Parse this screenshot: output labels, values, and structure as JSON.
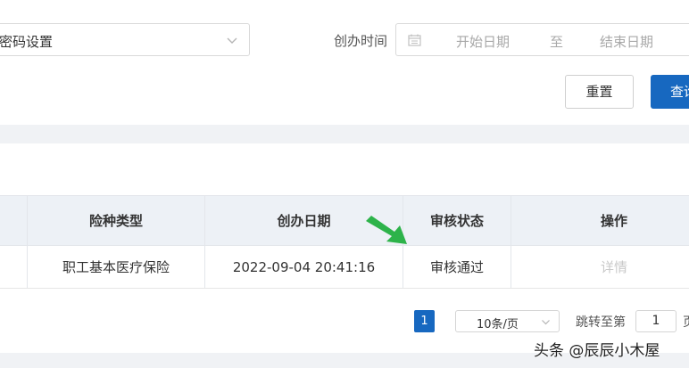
{
  "filters": {
    "category_select_value": "密码设置",
    "date_label": "创办时间",
    "date_start_placeholder": "开始日期",
    "date_separator": "至",
    "date_end_placeholder": "结束日期"
  },
  "buttons": {
    "reset_label": "重置",
    "search_label": "查询"
  },
  "table": {
    "headers": [
      "",
      "险种类型",
      "创办日期",
      "审核状态",
      "操作"
    ],
    "rows": [
      {
        "checkbox": "",
        "insurance_type": "职工基本医疗保险",
        "created_date": "2022-09-04 20:41:16",
        "review_status": "审核通过",
        "action": "详情"
      }
    ]
  },
  "pagination": {
    "current_page": "1",
    "page_size": "10条/页",
    "jump_label": "跳转至第",
    "jump_value": "1",
    "jump_suffix": "页"
  },
  "watermark": "头条 @辰辰小木屋",
  "colors": {
    "primary": "#1768c0",
    "arrow": "#2db34a",
    "header_bg": "#edf1f6",
    "page_bg": "#f0f2f5"
  },
  "icons": [
    "chevron-down-icon",
    "calendar-icon",
    "green-arrow-icon"
  ]
}
